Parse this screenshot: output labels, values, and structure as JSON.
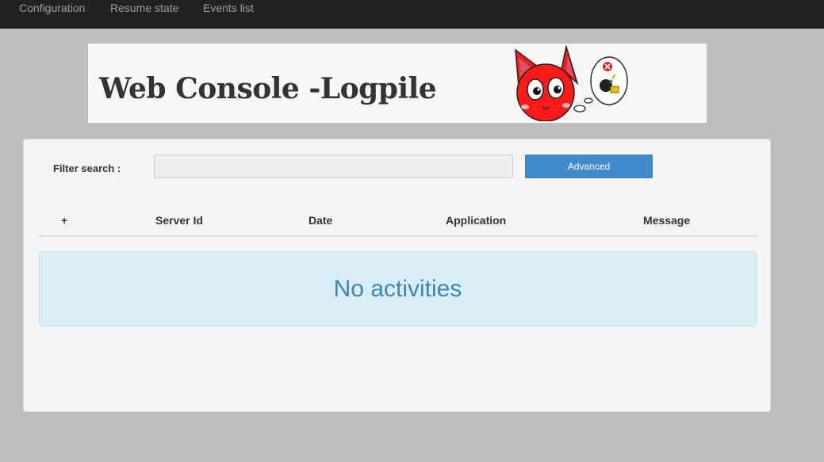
{
  "nav": {
    "items": [
      {
        "label": "Configuration"
      },
      {
        "label": "Resume state"
      },
      {
        "label": "Events list"
      }
    ]
  },
  "banner": {
    "title": "Web Console -Logpile",
    "mascot_icon": "red-cat-mascot-icon",
    "thought_icon": "bomb-error-icon"
  },
  "filter": {
    "label": "Filter search :",
    "value": "",
    "placeholder": "",
    "advanced_label": "Advanced"
  },
  "table": {
    "columns": [
      "+",
      "Server Id",
      "Date",
      "Application",
      "Message"
    ]
  },
  "empty_state": {
    "text": "No activities"
  },
  "colors": {
    "navbar_bg": "#222222",
    "nav_text": "#9d9d9d",
    "page_bg": "#bdbdbd",
    "primary_button": "#428bca",
    "info_bg": "#d9edf7",
    "info_text": "#3a87ad",
    "mascot_red": "#ff1a1a"
  }
}
